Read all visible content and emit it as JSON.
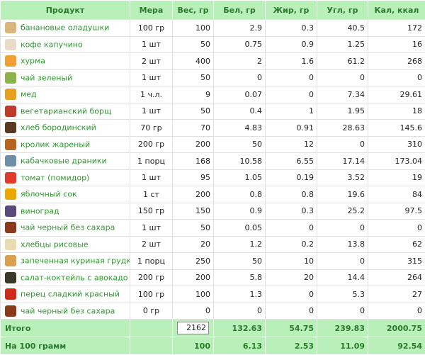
{
  "headers": [
    "Продукт",
    "Мера",
    "Вес, гр",
    "Бел, гр",
    "Жир, гр",
    "Угл, гр",
    "Кал, ккал"
  ],
  "rows": [
    {
      "product": "банановые оладушки",
      "measure": "100 гр",
      "weight": "100",
      "protein": "2.9",
      "fat": "0.3",
      "carbs": "40.5",
      "kcal": "172",
      "icon": "pancake-icon",
      "color": "#d9b77a"
    },
    {
      "product": "кофе капучино",
      "measure": "1 шт",
      "weight": "50",
      "protein": "0.75",
      "fat": "0.9",
      "carbs": "1.25",
      "kcal": "16",
      "icon": "coffee-cup-icon",
      "color": "#e8dcc8"
    },
    {
      "product": "хурма",
      "measure": "2 шт",
      "weight": "400",
      "protein": "2",
      "fat": "1.6",
      "carbs": "61.2",
      "kcal": "268",
      "icon": "persimmon-icon",
      "color": "#f0a030"
    },
    {
      "product": "чай зеленый",
      "measure": "1 шт",
      "weight": "50",
      "protein": "0",
      "fat": "0",
      "carbs": "0",
      "kcal": "0",
      "icon": "green-tea-icon",
      "color": "#8bb34a"
    },
    {
      "product": "мед",
      "measure": "1 ч.л.",
      "weight": "9",
      "protein": "0.07",
      "fat": "0",
      "carbs": "7.34",
      "kcal": "29.61",
      "icon": "honey-icon",
      "color": "#e8a020"
    },
    {
      "product": "вегетарианский борщ",
      "measure": "1 шт",
      "weight": "50",
      "protein": "0.4",
      "fat": "1",
      "carbs": "1.95",
      "kcal": "18",
      "icon": "borscht-icon",
      "color": "#c0392b"
    },
    {
      "product": "хлеб бородинский",
      "measure": "70 гр",
      "weight": "70",
      "protein": "4.83",
      "fat": "0.91",
      "carbs": "28.63",
      "kcal": "145.6",
      "icon": "rye-bread-icon",
      "color": "#5b3a22"
    },
    {
      "product": "кролик жареный",
      "measure": "200 гр",
      "weight": "200",
      "protein": "50",
      "fat": "12",
      "carbs": "0",
      "kcal": "310",
      "icon": "roast-rabbit-icon",
      "color": "#b5651d"
    },
    {
      "product": "кабачковые драники",
      "measure": "1 порц",
      "weight": "168",
      "protein": "10.58",
      "fat": "6.55",
      "carbs": "17.14",
      "kcal": "173.04",
      "icon": "zucchini-pancake-icon",
      "color": "#6f8fa8"
    },
    {
      "product": "томат (помидор)",
      "measure": "1 шт",
      "weight": "95",
      "protein": "1.05",
      "fat": "0.19",
      "carbs": "3.52",
      "kcal": "19",
      "icon": "tomato-icon",
      "color": "#e03a2a"
    },
    {
      "product": "яблочный сок",
      "measure": "1 ст",
      "weight": "200",
      "protein": "0.8",
      "fat": "0.8",
      "carbs": "19.6",
      "kcal": "84",
      "icon": "apple-juice-icon",
      "color": "#e8a800"
    },
    {
      "product": "виноград",
      "measure": "150 гр",
      "weight": "150",
      "protein": "0.9",
      "fat": "0.3",
      "carbs": "25.2",
      "kcal": "97.5",
      "icon": "grapes-icon",
      "color": "#5a4a7a"
    },
    {
      "product": "чай черный без сахара",
      "measure": "1 шт",
      "weight": "50",
      "protein": "0.05",
      "fat": "0",
      "carbs": "0",
      "kcal": "0",
      "icon": "black-tea-icon",
      "color": "#8a3a1a"
    },
    {
      "product": "хлебцы рисовые",
      "measure": "2 шт",
      "weight": "20",
      "protein": "1.2",
      "fat": "0.2",
      "carbs": "13.8",
      "kcal": "62",
      "icon": "rice-cakes-icon",
      "color": "#e8dcb0"
    },
    {
      "product": "запеченная куриная грудка",
      "measure": "1 порц",
      "weight": "250",
      "protein": "50",
      "fat": "10",
      "carbs": "0",
      "kcal": "315",
      "icon": "baked-chicken-icon",
      "color": "#d9a050"
    },
    {
      "product": "салат-коктейль с авокадо",
      "measure": "200 гр",
      "weight": "200",
      "protein": "5.8",
      "fat": "20",
      "carbs": "14.4",
      "kcal": "264",
      "icon": "avocado-salad-icon",
      "color": "#3a3a2a"
    },
    {
      "product": "перец сладкий красный",
      "measure": "100 гр",
      "weight": "100",
      "protein": "1.3",
      "fat": "0",
      "carbs": "5.3",
      "kcal": "27",
      "icon": "red-pepper-icon",
      "color": "#d02a1a"
    },
    {
      "product": "чай черный без сахара",
      "measure": "0 гр",
      "weight": "0",
      "protein": "0",
      "fat": "0",
      "carbs": "0",
      "kcal": "0",
      "icon": "black-tea-icon",
      "color": "#8a3a1a"
    }
  ],
  "total": {
    "label": "Итого",
    "weight": "2162",
    "protein": "132.63",
    "fat": "54.75",
    "carbs": "239.83",
    "kcal": "2000.75"
  },
  "per100": {
    "label": "На 100 грамм",
    "weight": "100",
    "protein": "6.13",
    "fat": "2.53",
    "carbs": "11.09",
    "kcal": "92.54"
  }
}
